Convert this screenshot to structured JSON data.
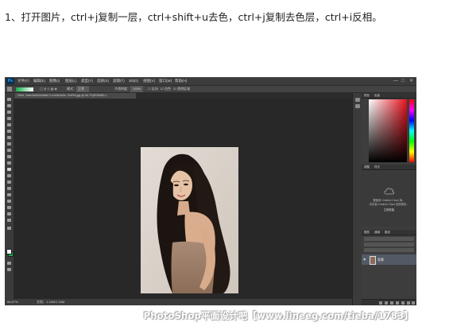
{
  "instruction": "1、打开图片，ctrl+j复制一层，ctrl+shift+u去色，ctrl+j复制去色层，ctrl+i反相。",
  "app": {
    "logo": "Ps",
    "menus": [
      "文件(F)",
      "编辑(E)",
      "图像(I)",
      "图层(L)",
      "类型(Y)",
      "选择(S)",
      "滤镜(T)",
      "3D(D)",
      "视图(V)",
      "窗口(W)",
      "帮助(H)"
    ],
    "window_controls": [
      "—",
      "□",
      "✕"
    ]
  },
  "options_bar": {
    "mode_label": "模式：",
    "mode_value": "正常",
    "opacity_label": "不透明度：",
    "opacity_value": "100%",
    "reverse_label": "反向",
    "dither_label": "仿色",
    "transparency_label": "透明区域"
  },
  "document": {
    "tab_title": "7d3e1 7acfc3a0b2e0a8e0 4 d1e5e2a0e. PreRef.jpg @ 66.7%(RGB/8#) ×"
  },
  "status": {
    "zoom": "66.67%",
    "doc_size": "文档：1.24M/1.24M"
  },
  "panels": {
    "color_tab": "颜色",
    "swatches_tab": "色板",
    "adjust_tab": "调整",
    "styles_tab": "样式",
    "library_msg_1": "要使用 Creative Cloud 库，",
    "library_msg_2": "请安装 Creative Cloud 应用程序。",
    "library_link": "立即安装",
    "layers_tab": "图层",
    "channels_tab": "通道",
    "paths_tab": "路径",
    "layer_name": "背景"
  },
  "watermark": "PhotoShop平面设计吧【www.lineeg.com/tieba/1783】",
  "colors": {
    "background_color": "#12b048",
    "foreground_color": "#ffffff"
  }
}
